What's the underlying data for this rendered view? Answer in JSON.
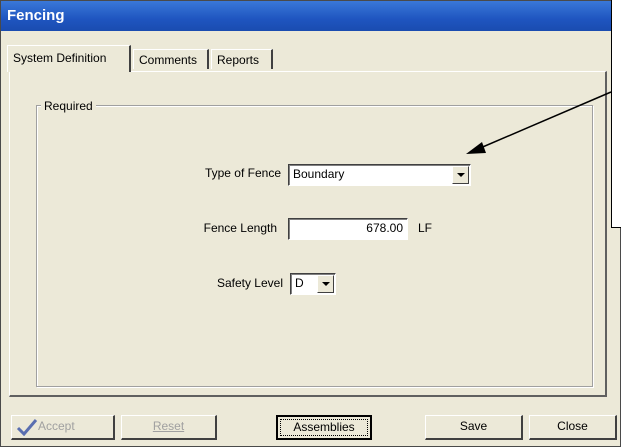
{
  "window": {
    "title": "Fencing"
  },
  "tabs": [
    {
      "label": "System Definition",
      "active": true
    },
    {
      "label": "Comments",
      "active": false
    },
    {
      "label": "Reports",
      "active": false
    }
  ],
  "group": {
    "legend": "Required"
  },
  "form": {
    "type_of_fence": {
      "label": "Type of Fence",
      "value": "Boundary"
    },
    "fence_length": {
      "label": "Fence Length",
      "value": "678.00",
      "unit": "LF"
    },
    "safety_level": {
      "label": "Safety Level",
      "value": "D"
    }
  },
  "buttons": {
    "accept": "Accept",
    "reset": "Reset",
    "assemblies": "Assemblies",
    "save": "Save",
    "close": "Close"
  },
  "icons": {
    "accept": "checkmark-icon",
    "dropdown": "chevron-down-icon"
  }
}
